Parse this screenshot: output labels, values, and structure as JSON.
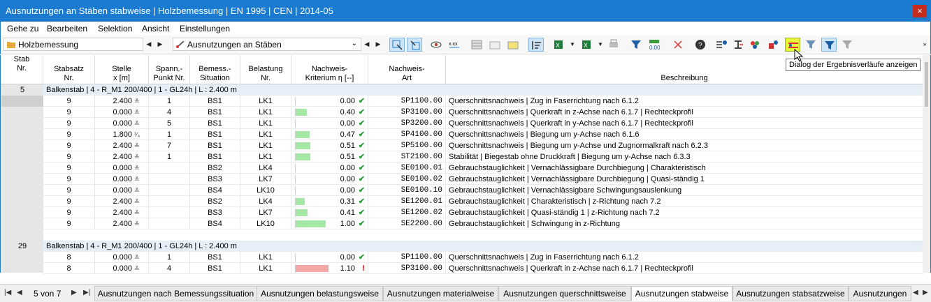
{
  "window": {
    "title": "Ausnutzungen an Stäben stabweise | Holzbemessung | EN 1995 | CEN | 2014-05",
    "close_label": "×"
  },
  "menu": [
    "Gehe zu",
    "Bearbeiten",
    "Selektion",
    "Ansicht",
    "Einstellungen"
  ],
  "toolbar": {
    "module_combo": "Holzbemessung",
    "result_combo": "Ausnutzungen an Stäben",
    "highlighted_button": "dialog-ergebnisverlaeufe",
    "tooltip": "Dialog der Ergebnisverläufe anzeigen"
  },
  "columns": {
    "stab": "Stab\nNr.",
    "stabsatz": "Stabsatz\nNr.",
    "stelle": "Stelle\nx [m]",
    "spann": "Spann.-\nPunkt Nr.",
    "bemess": "Bemess.-\nSituation",
    "belastung": "Belastung\nNr.",
    "kriterium": "Nachweis-\nKriterium η [--]",
    "art": "Nachweis-\nArt",
    "beschreibung": "Beschreibung"
  },
  "groups": [
    {
      "stab": "5",
      "header": "Balkenstab | 4 - R_M1 200/400 | 1 - GL24h | L : 2.400 m",
      "rows": [
        {
          "satz": "9",
          "stelle": "2.400",
          "mark": "≚",
          "spann": "1",
          "sit": "BS1",
          "last": "LK1",
          "eta": "0.00",
          "val": 0.0,
          "ok": true,
          "art": "SP1100.00",
          "desc": "Querschnittsnachweis | Zug in Faserrichtung nach 6.1.2"
        },
        {
          "satz": "9",
          "stelle": "0.000",
          "mark": "≚",
          "spann": "4",
          "sit": "BS1",
          "last": "LK1",
          "eta": "0.40",
          "val": 0.4,
          "ok": true,
          "art": "SP3100.00",
          "desc": "Querschnittsnachweis | Querkraft in z-Achse nach 6.1.7 | Rechteckprofil"
        },
        {
          "satz": "9",
          "stelle": "0.000",
          "mark": "≚",
          "spann": "5",
          "sit": "BS1",
          "last": "LK1",
          "eta": "0.00",
          "val": 0.0,
          "ok": true,
          "art": "SP3200.00",
          "desc": "Querschnittsnachweis | Querkraft in y-Achse nach 6.1.7 | Rechteckprofil"
        },
        {
          "satz": "9",
          "stelle": "1.800",
          "mark": "³⁄₄",
          "spann": "1",
          "sit": "BS1",
          "last": "LK1",
          "eta": "0.47",
          "val": 0.47,
          "ok": true,
          "art": "SP4100.00",
          "desc": "Querschnittsnachweis | Biegung um y-Achse nach 6.1.6"
        },
        {
          "satz": "9",
          "stelle": "2.400",
          "mark": "≚",
          "spann": "7",
          "sit": "BS1",
          "last": "LK1",
          "eta": "0.51",
          "val": 0.51,
          "ok": true,
          "art": "SP5100.00",
          "desc": "Querschnittsnachweis | Biegung um y-Achse und Zugnormalkraft nach 6.2.3"
        },
        {
          "satz": "9",
          "stelle": "2.400",
          "mark": "≚",
          "spann": "1",
          "sit": "BS1",
          "last": "LK1",
          "eta": "0.51",
          "val": 0.51,
          "ok": true,
          "art": "ST2100.00",
          "desc": "Stabilität | Biegestab ohne Druckkraft | Biegung um y-Achse nach 6.3.3"
        },
        {
          "satz": "9",
          "stelle": "0.000",
          "mark": "≚",
          "spann": "",
          "sit": "BS2",
          "last": "LK4",
          "eta": "0.00",
          "val": 0.0,
          "ok": true,
          "art": "SE0100.01",
          "desc": "Gebrauchstauglichkeit | Vernachlässigbare Durchbiegung | Charakteristisch"
        },
        {
          "satz": "9",
          "stelle": "0.000",
          "mark": "≚",
          "spann": "",
          "sit": "BS3",
          "last": "LK7",
          "eta": "0.00",
          "val": 0.0,
          "ok": true,
          "art": "SE0100.02",
          "desc": "Gebrauchstauglichkeit | Vernachlässigbare Durchbiegung | Quasi-ständig 1"
        },
        {
          "satz": "9",
          "stelle": "0.000",
          "mark": "≚",
          "spann": "",
          "sit": "BS4",
          "last": "LK10",
          "eta": "0.00",
          "val": 0.0,
          "ok": true,
          "art": "SE0100.10",
          "desc": "Gebrauchstauglichkeit | Vernachlässigbare Schwingungsauslenkung"
        },
        {
          "satz": "9",
          "stelle": "2.400",
          "mark": "≚",
          "spann": "",
          "sit": "BS2",
          "last": "LK4",
          "eta": "0.31",
          "val": 0.31,
          "ok": true,
          "art": "SE1200.01",
          "desc": "Gebrauchstauglichkeit | Charakteristisch | z-Richtung nach 7.2"
        },
        {
          "satz": "9",
          "stelle": "2.400",
          "mark": "≚",
          "spann": "",
          "sit": "BS3",
          "last": "LK7",
          "eta": "0.41",
          "val": 0.41,
          "ok": true,
          "art": "SE1200.02",
          "desc": "Gebrauchstauglichkeit | Quasi-ständig 1 | z-Richtung nach 7.2"
        },
        {
          "satz": "9",
          "stelle": "2.400",
          "mark": "≚",
          "spann": "",
          "sit": "BS4",
          "last": "LK10",
          "eta": "1.00",
          "val": 1.0,
          "ok": true,
          "art": "SE2200.00",
          "desc": "Gebrauchstauglichkeit | Schwingung in z-Richtung"
        }
      ]
    },
    {
      "stab": "29",
      "header": "Balkenstab | 4 - R_M1 200/400 | 1 - GL24h | L : 2.400 m",
      "rows": [
        {
          "satz": "8",
          "stelle": "0.000",
          "mark": "≚",
          "spann": "1",
          "sit": "BS1",
          "last": "LK1",
          "eta": "0.00",
          "val": 0.0,
          "ok": true,
          "art": "SP1100.00",
          "desc": "Querschnittsnachweis | Zug in Faserrichtung nach 6.1.2"
        },
        {
          "satz": "8",
          "stelle": "0.000",
          "mark": "≚",
          "spann": "4",
          "sit": "BS1",
          "last": "LK1",
          "eta": "1.10",
          "val": 1.1,
          "ok": false,
          "art": "SP3100.00",
          "desc": "Querschnittsnachweis | Querkraft in z-Achse nach 6.1.7 | Rechteckprofil"
        }
      ]
    }
  ],
  "colors": {
    "ok_bar": "#a6e8a6",
    "fail_bar": "#f4a8a8",
    "ok_icon": "#2a9a3a",
    "fail_icon": "#d40000",
    "accent": "#1a7bd0"
  },
  "pager": {
    "label": "5 von 7"
  },
  "tabs": [
    "Ausnutzungen nach Bemessungssituation",
    "Ausnutzungen belastungsweise",
    "Ausnutzungen materialweise",
    "Ausnutzungen querschnittsweise",
    "Ausnutzungen stabweise",
    "Ausnutzungen stabsatzweise",
    "Ausnutzungen"
  ],
  "active_tab": 4
}
